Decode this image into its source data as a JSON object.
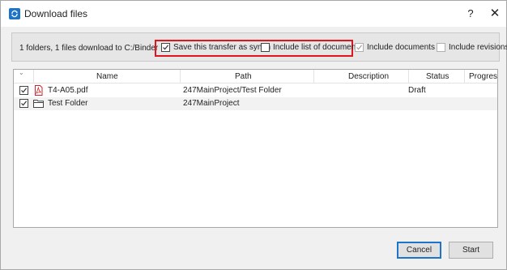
{
  "window": {
    "title": "Download files",
    "help_glyph": "?",
    "close_glyph": "✕"
  },
  "info": {
    "summary": "1 folders, 1 files download to C:/Binder",
    "options": [
      {
        "label": "Save this transfer as synch",
        "checked": true,
        "enabled": true
      },
      {
        "label": "Include list of documents",
        "checked": false,
        "enabled": true
      },
      {
        "label": "Include documents",
        "checked": true,
        "enabled": false
      },
      {
        "label": "Include revisions",
        "checked": false,
        "enabled": false
      }
    ],
    "highlight_color": "#e0161e"
  },
  "grid": {
    "columns": [
      "Name",
      "Path",
      "Description",
      "Status",
      "Progress"
    ],
    "rows": [
      {
        "checked": true,
        "icon": "pdf-file-icon",
        "name": "T4-A05.pdf",
        "path": "247MainProject/Test Folder",
        "description": "",
        "status": "Draft",
        "progress": ""
      },
      {
        "checked": true,
        "icon": "folder-icon",
        "name": "Test Folder",
        "path": "247MainProject",
        "description": "",
        "status": "",
        "progress": ""
      }
    ]
  },
  "buttons": {
    "cancel": "Cancel",
    "start": "Start"
  },
  "colors": {
    "accent": "#1e74c8",
    "pdf_red": "#d0232a"
  }
}
